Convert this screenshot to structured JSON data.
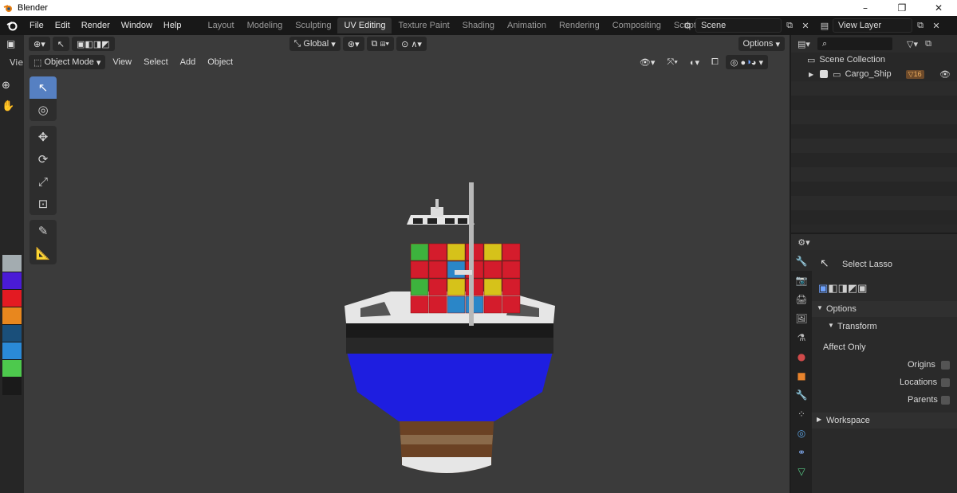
{
  "window": {
    "title": "Blender",
    "controls": [
      "–",
      "❐",
      "✕"
    ]
  },
  "menu": [
    "File",
    "Edit",
    "Render",
    "Window",
    "Help"
  ],
  "workspaces": [
    {
      "label": "Layout",
      "active": false
    },
    {
      "label": "Modeling",
      "active": false
    },
    {
      "label": "Sculpting",
      "active": false
    },
    {
      "label": "UV Editing",
      "active": true
    },
    {
      "label": "Texture Paint",
      "active": false
    },
    {
      "label": "Shading",
      "active": false
    },
    {
      "label": "Animation",
      "active": false
    },
    {
      "label": "Rendering",
      "active": false
    },
    {
      "label": "Compositing",
      "active": false
    },
    {
      "label": "Scripting",
      "active": false
    }
  ],
  "scene": {
    "name": "Scene"
  },
  "view_layer": {
    "name": "View Layer"
  },
  "viewport": {
    "transform_orientation": "Global",
    "options_label": "Options",
    "mode_label": "Object Mode",
    "header_menus": [
      "View",
      "Select",
      "Add",
      "Object"
    ],
    "side_label": "Vie"
  },
  "palette_colors": [
    "#a3acb0",
    "#4a1bd6",
    "#e31a22",
    "#e8871e",
    "#1a4f7a",
    "#2a8ad8",
    "#4dc94d",
    "#1a1a1a"
  ],
  "outliner": {
    "root": "Scene Collection",
    "items": [
      {
        "label": "Cargo_Ship",
        "badge": "16"
      }
    ]
  },
  "properties": {
    "active_tool": "Select Lasso",
    "options_panel": "Options",
    "transform_sub": "Transform",
    "affect_only_label": "Affect Only",
    "checks": [
      {
        "label": "Origins",
        "checked": false
      },
      {
        "label": "Locations",
        "checked": false
      },
      {
        "label": "Parents",
        "checked": false
      }
    ],
    "workspace_panel": "Workspace"
  },
  "ship_colors": {
    "hull_blue": "#1e1ee0",
    "hull_stripe": "#1a1a1a",
    "deck_white": "#e6e6e6",
    "base_brown": "#6b4224",
    "green": "#3db33d",
    "red": "#d41c2c",
    "yellow": "#d6c21a",
    "blue_box": "#2a86c8"
  }
}
